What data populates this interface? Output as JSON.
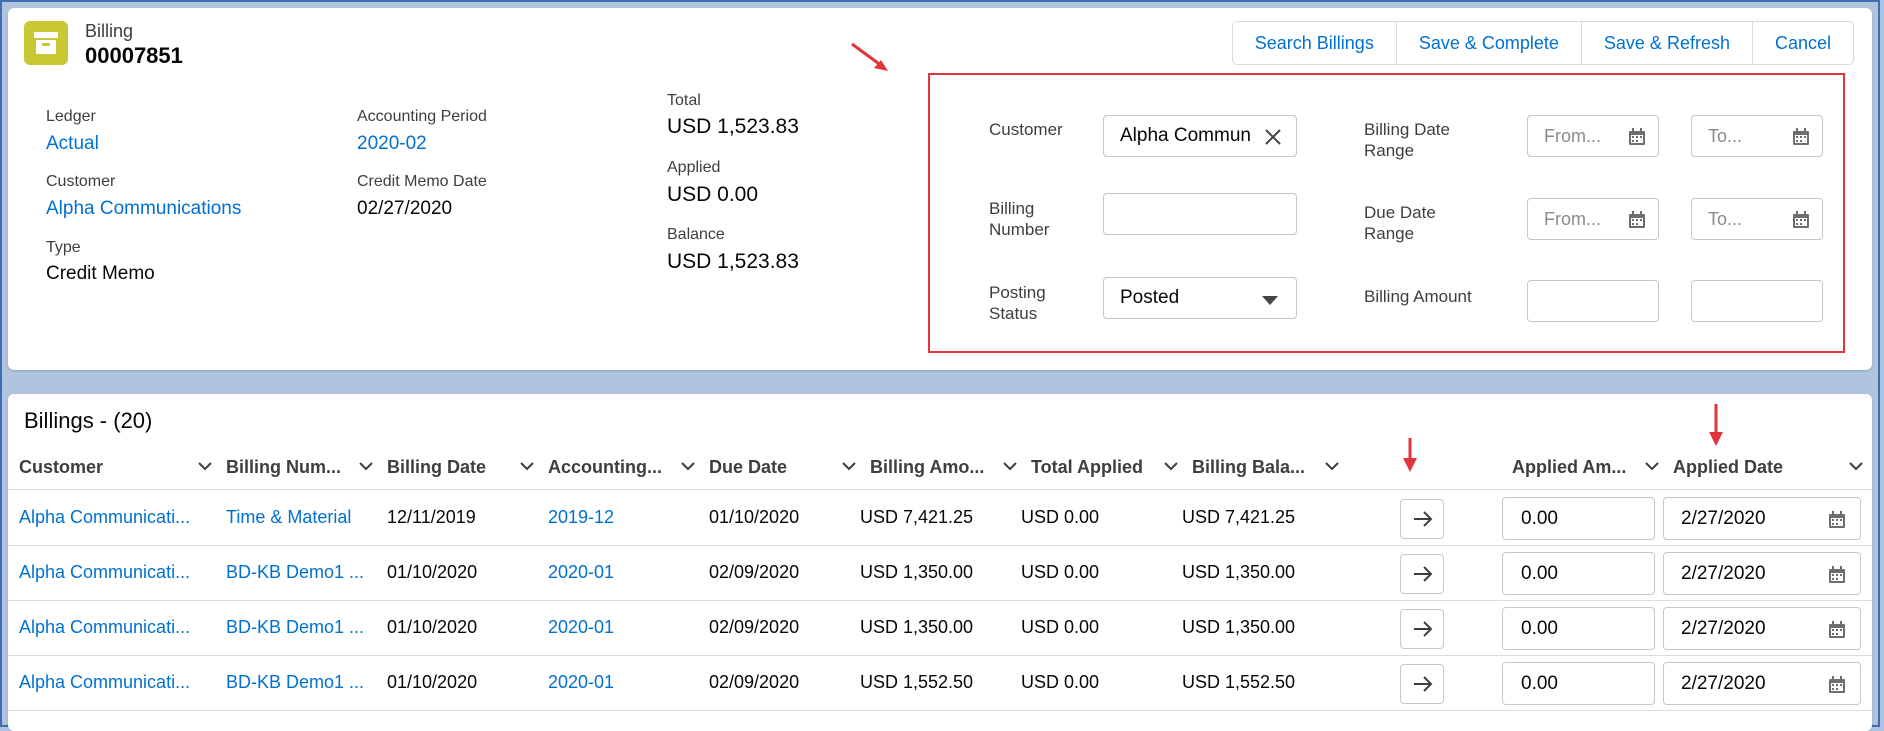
{
  "header": {
    "object_type": "Billing",
    "record_name": "00007851",
    "icon": "billing-archive-icon",
    "buttons": [
      "Search Billings",
      "Save & Complete",
      "Save & Refresh",
      "Cancel"
    ]
  },
  "details": {
    "ledger_label": "Ledger",
    "ledger_value": "Actual",
    "customer_label": "Customer",
    "customer_value": "Alpha Communications",
    "type_label": "Type",
    "type_value": "Credit Memo",
    "period_label": "Accounting Period",
    "period_value": "2020-02",
    "memo_date_label": "Credit Memo Date",
    "memo_date_value": "02/27/2020",
    "total_label": "Total",
    "total_value": "USD 1,523.83",
    "applied_label": "Applied",
    "applied_value": "USD 0.00",
    "balance_label": "Balance",
    "balance_value": "USD 1,523.83"
  },
  "filters": {
    "customer_label": "Customer",
    "customer_value": "Alpha Commun",
    "billing_number_label_1": "Billing",
    "billing_number_label_2": "Number",
    "billing_number_value": "",
    "posting_status_label_1": "Posting",
    "posting_status_label_2": "Status",
    "posting_status_value": "Posted",
    "billing_date_label_1": "Billing Date",
    "billing_date_label_2": "Range",
    "due_date_label_1": "Due Date",
    "due_date_label_2": "Range",
    "billing_amount_label": "Billing Amount",
    "from_placeholder": "From...",
    "to_placeholder": "To..."
  },
  "table": {
    "title": "Billings - (20)",
    "columns": [
      "Customer",
      "Billing Num...",
      "Billing Date",
      "Accounting...",
      "Due Date",
      "Billing Amo...",
      "Total Applied",
      "Billing Bala...",
      "Applied Am...",
      "Applied Date"
    ],
    "rows": [
      {
        "customer": "Alpha Communicati...",
        "billing_number": "Time & Material",
        "billing_date": "12/11/2019",
        "period": "2019-12",
        "due_date": "01/10/2020",
        "billing_amount": "USD 7,421.25",
        "total_applied": "USD 0.00",
        "billing_balance": "USD 7,421.25",
        "applied_amount": "0.00",
        "applied_date": "2/27/2020"
      },
      {
        "customer": "Alpha Communicati...",
        "billing_number": "BD-KB Demo1 ...",
        "billing_date": "01/10/2020",
        "period": "2020-01",
        "due_date": "02/09/2020",
        "billing_amount": "USD 1,350.00",
        "total_applied": "USD 0.00",
        "billing_balance": "USD 1,350.00",
        "applied_amount": "0.00",
        "applied_date": "2/27/2020"
      },
      {
        "customer": "Alpha Communicati...",
        "billing_number": "BD-KB Demo1 ...",
        "billing_date": "01/10/2020",
        "period": "2020-01",
        "due_date": "02/09/2020",
        "billing_amount": "USD 1,350.00",
        "total_applied": "USD 0.00",
        "billing_balance": "USD 1,350.00",
        "applied_amount": "0.00",
        "applied_date": "2/27/2020"
      },
      {
        "customer": "Alpha Communicati...",
        "billing_number": "BD-KB Demo1 ...",
        "billing_date": "01/10/2020",
        "period": "2020-01",
        "due_date": "02/09/2020",
        "billing_amount": "USD 1,552.50",
        "total_applied": "USD 0.00",
        "billing_balance": "USD 1,552.50",
        "applied_amount": "0.00",
        "applied_date": "2/27/2020"
      }
    ]
  },
  "colors": {
    "link": "#0070d2",
    "annotation_red": "#e0353b",
    "icon_bg": "#c8c834",
    "page_bg": "#b0c4df"
  }
}
